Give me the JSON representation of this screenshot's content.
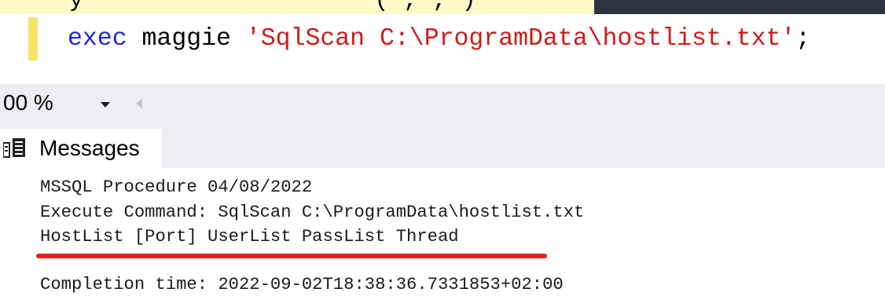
{
  "editor": {
    "previous_line": "y                    ( , , )",
    "code_line": {
      "keyword": "exec",
      "identifier": " maggie ",
      "string": "'SqlScan C:\\ProgramData\\hostlist.txt'",
      "terminator": ";"
    }
  },
  "zoom": {
    "value": "00 %"
  },
  "results": {
    "tab_label": "Messages",
    "icon": "messages-icon"
  },
  "messages": [
    "MSSQL Procedure 04/08/2022",
    "Execute Command: SqlScan C:\\ProgramData\\hostlist.txt",
    "HostList [Port] UserList PassList Thread",
    "",
    "Completion time: 2022-09-02T18:38:36.7331853+02:00"
  ],
  "colors": {
    "keyword": "#1e27d6",
    "string": "#d11a1a",
    "change_bar": "#f3e469",
    "annotation_underline": "#e32020"
  }
}
